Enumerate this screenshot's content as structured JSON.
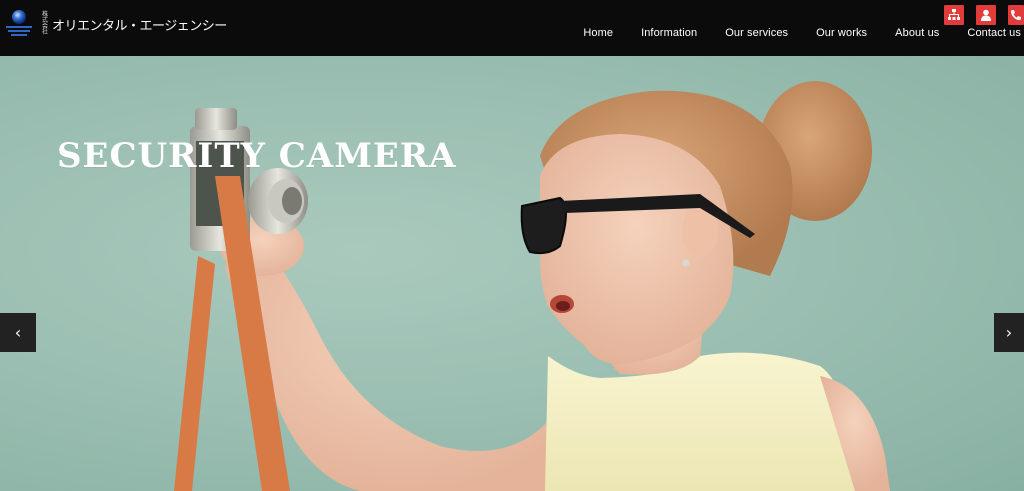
{
  "header": {
    "logo_kabu": "株式会社",
    "logo_name": "オリエンタル・エージェンシー",
    "social": [
      {
        "icon": "sitemap-icon"
      },
      {
        "icon": "user-icon"
      },
      {
        "icon": "phone-icon"
      }
    ],
    "accent_color": "#e23b3b",
    "nav": [
      "Home",
      "Information",
      "Our services",
      "Our works",
      "About us",
      "Contact us"
    ]
  },
  "hero": {
    "title": "SECURITY CAMERA",
    "prev_label": "‹",
    "next_label": "›"
  }
}
